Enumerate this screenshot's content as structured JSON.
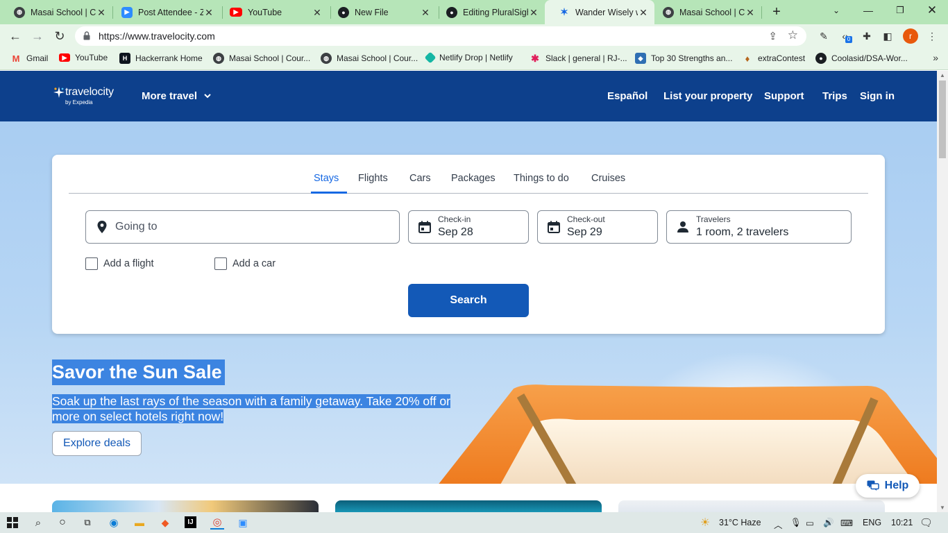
{
  "browser": {
    "tabs": [
      {
        "title": "Masai School | Co",
        "icon": "globe-icon",
        "active": false
      },
      {
        "title": "Post Attendee - Z",
        "icon": "zoom-icon",
        "active": false
      },
      {
        "title": "YouTube",
        "icon": "youtube-icon",
        "active": false
      },
      {
        "title": "New File",
        "icon": "github-icon",
        "active": false
      },
      {
        "title": "Editing PluralSigh",
        "icon": "github-icon",
        "active": false
      },
      {
        "title": "Wander Wisely w",
        "icon": "travelocity-icon",
        "active": true
      },
      {
        "title": "Masai School | Co",
        "icon": "globe-icon",
        "active": false
      }
    ],
    "close_glyph": "✕",
    "url": "https://www.travelocity.com",
    "profile_initial": "r",
    "extension_badge": "0",
    "bookmarks": [
      {
        "label": "Gmail",
        "icon": "gmail-icon"
      },
      {
        "label": "YouTube",
        "icon": "youtube-icon"
      },
      {
        "label": "Hackerrank Home",
        "icon": "hackerrank-icon"
      },
      {
        "label": "Masai School | Cour...",
        "icon": "globe-icon"
      },
      {
        "label": "Masai School | Cour...",
        "icon": "globe-icon"
      },
      {
        "label": "Netlify Drop | Netlify",
        "icon": "netlify-icon"
      },
      {
        "label": "Slack | general | RJ-...",
        "icon": "slack-icon"
      },
      {
        "label": "Top 30 Strengths an...",
        "icon": "strengths-icon"
      },
      {
        "label": "extraContest",
        "icon": "contest-icon"
      },
      {
        "label": "Coolasid/DSA-Wor...",
        "icon": "github-icon"
      }
    ]
  },
  "site": {
    "logo_text": "travelocity",
    "logo_sub": "by Expedia",
    "more_travel": "More travel",
    "nav": [
      "Español",
      "List your property",
      "Support",
      "Trips",
      "Sign in"
    ]
  },
  "search": {
    "tabs": [
      "Stays",
      "Flights",
      "Cars",
      "Packages",
      "Things to do",
      "Cruises"
    ],
    "active_tab": "Stays",
    "destination_placeholder": "Going to",
    "checkin_label": "Check-in",
    "checkin_value": "Sep 28",
    "checkout_label": "Check-out",
    "checkout_value": "Sep 29",
    "travelers_label": "Travelers",
    "travelers_value": "1 room, 2 travelers",
    "add_flight": "Add a flight",
    "add_car": "Add a car",
    "button": "Search"
  },
  "promo": {
    "title": "Savor the Sun Sale",
    "text": "Soak up the last rays of the season with a family getaway. Take 20% off or more on select hotels right now!",
    "button": "Explore deals"
  },
  "help": "Help",
  "taskbar": {
    "weather": "31°C  Haze",
    "language": "ENG",
    "time": "10:21"
  },
  "colors": {
    "header_bg": "#0d408c",
    "accent": "#1668e3",
    "button_bg": "#1359b7",
    "tabstrip": "#b6e5b8"
  }
}
